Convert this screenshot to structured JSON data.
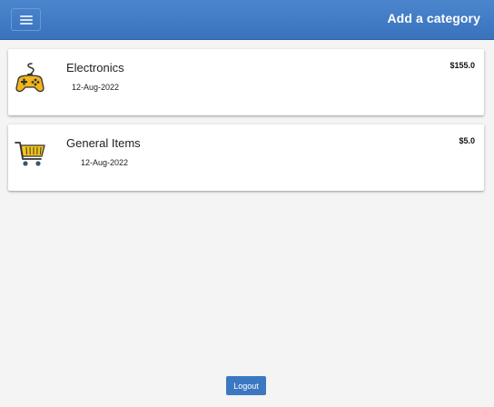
{
  "header": {
    "title": "Add a category",
    "menu_icon": "hamburger-menu-icon",
    "color": "#3a72bd"
  },
  "categories": [
    {
      "name": "Electronics",
      "date": "12-Aug-2022",
      "amount": "$155.0",
      "icon": "gamepad-icon"
    },
    {
      "name": "General Items",
      "date": "12-Aug-2022",
      "amount": "$5.0",
      "icon": "shopping-cart-icon"
    }
  ],
  "footer": {
    "logout_label": "Logout"
  }
}
